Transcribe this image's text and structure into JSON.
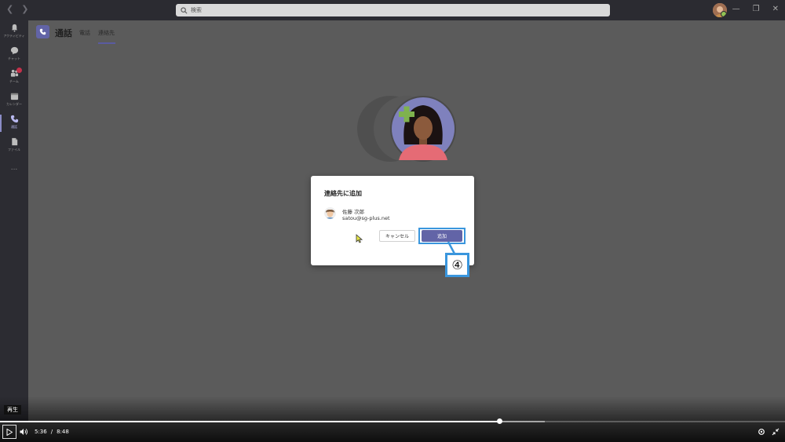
{
  "search": {
    "placeholder": "検索"
  },
  "rail": {
    "items": [
      {
        "label": "アクティビティ",
        "icon": "bell-icon",
        "active": false
      },
      {
        "label": "チャット",
        "icon": "chat-icon",
        "active": false
      },
      {
        "label": "チーム",
        "icon": "teams-icon",
        "active": false,
        "badge": true
      },
      {
        "label": "カレンダー",
        "icon": "calendar-icon",
        "active": false
      },
      {
        "label": "通話",
        "icon": "phone-icon",
        "active": true
      },
      {
        "label": "ファイル",
        "icon": "file-icon",
        "active": false
      }
    ],
    "more": "..."
  },
  "header": {
    "title": "通話",
    "tabs": [
      {
        "label": "電話",
        "active": false
      },
      {
        "label": "連絡先",
        "active": true
      }
    ]
  },
  "dialog": {
    "title": "連絡先に追加",
    "contact_name": "佐藤 次郎",
    "contact_email": "satou@sg-plus.net",
    "cancel_label": "キャンセル",
    "add_label": "追加"
  },
  "annotation": {
    "step": "④",
    "color": "#3a96dd"
  },
  "player": {
    "tooltip": "再生",
    "current_time": "5:36",
    "separator": "/",
    "duration": "8:48",
    "progress_fraction": 0.636,
    "buffered_fraction": 0.694
  },
  "colors": {
    "accent": "#6264a7",
    "highlight": "#3a96dd",
    "overlay": "#5b5b5b"
  }
}
